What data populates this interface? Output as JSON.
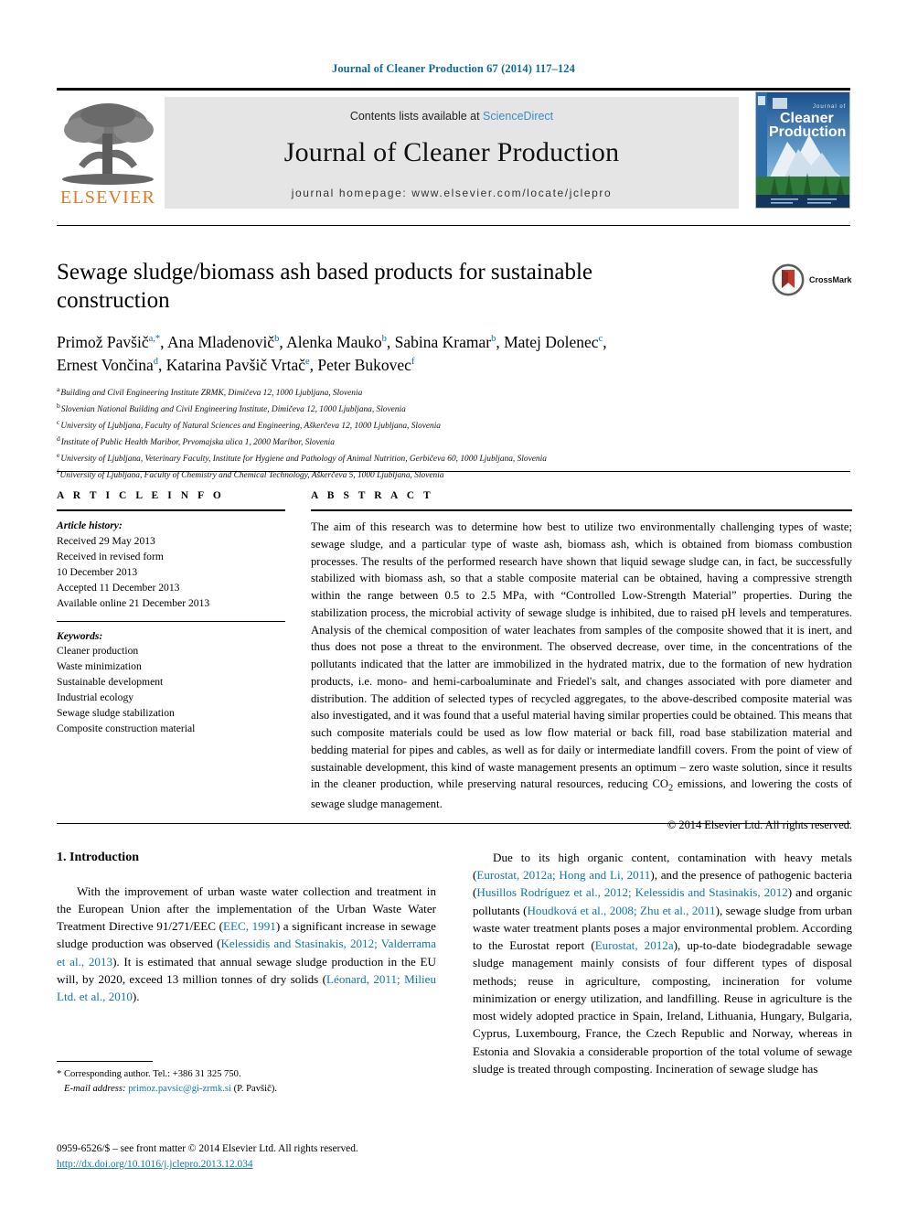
{
  "running_head": "Journal of Cleaner Production 67 (2014) 117–124",
  "masthead": {
    "publisher_name": "ELSEVIER",
    "contents_prefix": "Contents lists available at ",
    "contents_link": "ScienceDirect",
    "journal_title": "Journal of Cleaner Production",
    "homepage": "journal homepage: www.elsevier.com/locate/jclepro",
    "cover_line1": "Journal of",
    "cover_line2": "Cleaner",
    "cover_line3": "Production"
  },
  "article": {
    "title": "Sewage sludge/biomass ash based products for sustainable construction",
    "crossmark_label": "CrossMark",
    "authors_line1": "Primož Pavšič",
    "authors_line1_sup": "a,*",
    "authors_line1_rest": ", Ana Mladenovič",
    "authors": "Primož Pavšič a,*, Ana Mladenovič b, Alenka Mauko b, Sabina Kramar b, Matej Dolenec c, Ernest Vončina d, Katarina Pavšič Vrtač e, Peter Bukovec f",
    "affiliations": [
      {
        "mark": "a",
        "text": "Building and Civil Engineering Institute ZRMK, Dimičeva 12, 1000 Ljubljana, Slovenia"
      },
      {
        "mark": "b",
        "text": "Slovenian National Building and Civil Engineering Institute, Dimičeva 12, 1000 Ljubljana, Slovenia"
      },
      {
        "mark": "c",
        "text": "University of Ljubljana, Faculty of Natural Sciences and Engineering, Aškerčeva 12, 1000 Ljubljana, Slovenia"
      },
      {
        "mark": "d",
        "text": "Institute of Public Health Maribor, Prvomajska ulica 1, 2000 Maribor, Slovenia"
      },
      {
        "mark": "e",
        "text": "University of Ljubljana, Veterinary Faculty, Institute for Hygiene and Pathology of Animal Nutrition, Gerbičeva 60, 1000 Ljubljana, Slovenia"
      },
      {
        "mark": "f",
        "text": "University of Ljubljana, Faculty of Chemistry and Chemical Technology, Aškerčeva 5, 1000 Ljubljana, Slovenia"
      }
    ]
  },
  "article_info": {
    "heading": "A R T I C L E   I N F O",
    "history_label": "Article history:",
    "history": [
      "Received 29 May 2013",
      "Received in revised form",
      "10 December 2013",
      "Accepted 11 December 2013",
      "Available online 21 December 2013"
    ],
    "keywords_label": "Keywords:",
    "keywords": [
      "Cleaner production",
      "Waste minimization",
      "Sustainable development",
      "Industrial ecology",
      "Sewage sludge stabilization",
      "Composite construction material"
    ]
  },
  "abstract": {
    "heading": "A B S T R A C T",
    "text": "The aim of this research was to determine how best to utilize two environmentally challenging types of waste; sewage sludge, and a particular type of waste ash, biomass ash, which is obtained from biomass combustion processes. The results of the performed research have shown that liquid sewage sludge can, in fact, be successfully stabilized with biomass ash, so that a stable composite material can be obtained, having a compressive strength within the range between 0.5 to 2.5 MPa, with “Controlled Low-Strength Material” properties. During the stabilization process, the microbial activity of sewage sludge is inhibited, due to raised pH levels and temperatures. Analysis of the chemical composition of water leachates from samples of the composite showed that it is inert, and thus does not pose a threat to the environment. The observed decrease, over time, in the concentrations of the pollutants indicated that the latter are immobilized in the hydrated matrix, due to the formation of new hydration products, i.e. mono- and hemi-carboaluminate and Friedel's salt, and changes associated with pore diameter and distribution. The addition of selected types of recycled aggregates, to the above-described composite material was also investigated, and it was found that a useful material having similar properties could be obtained. This means that such composite materials could be used as low flow material or back fill, road base stabilization material and bedding material for pipes and cables, as well as for daily or intermediate landfill covers. From the point of view of sustainable development, this kind of waste management presents an optimum – zero waste solution, since it results in the cleaner production, while preserving natural resources, reducing CO",
    "text_sub": "2",
    "text_after": " emissions, and lowering the costs of sewage sludge management.",
    "copyright": "© 2014 Elsevier Ltd. All rights reserved."
  },
  "introduction": {
    "heading": "1. Introduction",
    "left_p1_a": "With the improvement of urban waste water collection and treatment in the European Union after the implementation of the Urban Waste Water Treatment Directive 91/271/EEC (",
    "left_cite1": "EEC, 1991",
    "left_p1_b": ") a significant increase in sewage sludge production was observed (",
    "left_cite2": "Kelessidis and Stasinakis, 2012; Valderrama et al., 2013",
    "left_p1_c": "). It is estimated that annual sewage sludge production in the EU will, by 2020, exceed 13 million tonnes of dry solids (",
    "left_cite3": "Léonard, 2011; Milieu Ltd. et al., 2010",
    "left_p1_d": ").",
    "right_p1_a": "Due to its high organic content, contamination with heavy metals (",
    "right_cite1": "Eurostat, 2012a; Hong and Li, 2011",
    "right_p1_b": "), and the presence of pathogenic bacteria (",
    "right_cite2": "Husillos Rodríguez et al., 2012; Kelessidis and Stasinakis, 2012",
    "right_p1_c": ") and organic pollutants (",
    "right_cite3": "Houdková et al., 2008; Zhu et al., 2011",
    "right_p1_d": "), sewage sludge from urban waste water treatment plants poses a major environmental problem. According to the Eurostat report (",
    "right_cite4": "Eurostat, 2012a",
    "right_p1_e": "), up-to-date biodegradable sewage sludge management mainly consists of four different types of disposal methods; reuse in agriculture, composting, incineration for volume minimization or energy utilization, and landfilling. Reuse in agriculture is the most widely adopted practice in Spain, Ireland, Lithuania, Hungary, Bulgaria, Cyprus, Luxembourg, France, the Czech Republic and Norway, whereas in Estonia and Slovakia a considerable proportion of the total volume of sewage sludge is treated through composting. Incineration of sewage sludge has"
  },
  "footnote": {
    "corresponding": "* Corresponding author. Tel.: +386 31 325 750.",
    "email_label": "E-mail address:",
    "email": "primoz.pavsic@gi-zrmk.si",
    "email_suffix": " (P. Pavšič)."
  },
  "imprint": {
    "line1": "0959-6526/$ – see front matter © 2014 Elsevier Ltd. All rights reserved.",
    "doi": "http://dx.doi.org/10.1016/j.jclepro.2013.12.034"
  },
  "colors": {
    "link": "#1277ab",
    "header_blue": "#0b6ba1",
    "elsevier_orange": "#e87722",
    "masthead_gray": "#e5e5e5"
  }
}
